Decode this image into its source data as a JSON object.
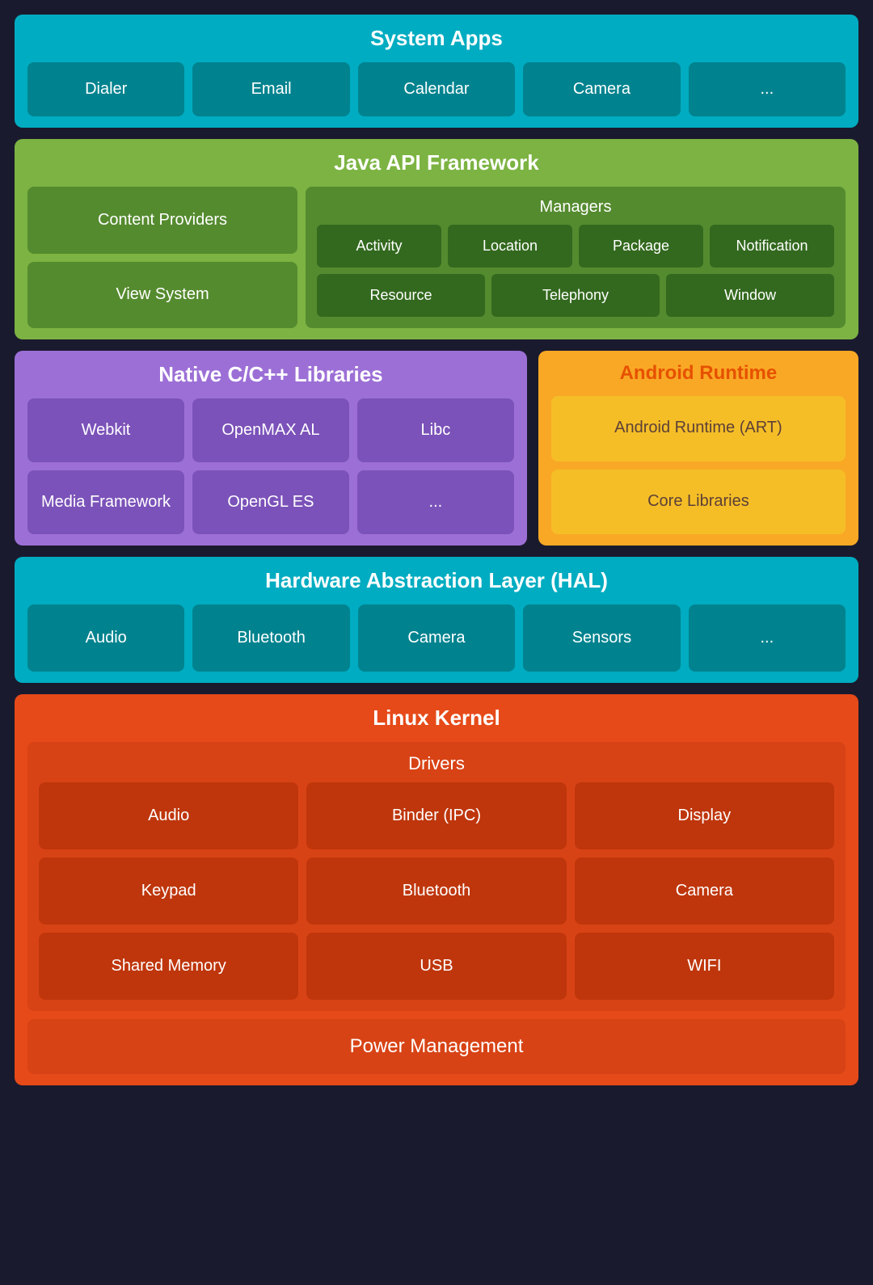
{
  "system_apps": {
    "title": "System Apps",
    "items": [
      "Dialer",
      "Email",
      "Calendar",
      "Camera",
      "..."
    ]
  },
  "java_api": {
    "title": "Java API Framework",
    "left": {
      "content_providers": "Content Providers",
      "view_system": "View System"
    },
    "managers": {
      "title": "Managers",
      "row1": [
        "Activity",
        "Location",
        "Package",
        "Notification"
      ],
      "row2": [
        "Resource",
        "Telephony",
        "Window"
      ]
    }
  },
  "native": {
    "title": "Native C/C++ Libraries",
    "items": [
      "Webkit",
      "OpenMAX AL",
      "Libc",
      "Media Framework",
      "OpenGL ES",
      "..."
    ]
  },
  "android_runtime": {
    "title": "Android Runtime",
    "items": [
      "Android Runtime (ART)",
      "Core Libraries"
    ]
  },
  "hal": {
    "title": "Hardware Abstraction Layer (HAL)",
    "items": [
      "Audio",
      "Bluetooth",
      "Camera",
      "Sensors",
      "..."
    ]
  },
  "linux_kernel": {
    "title": "Linux Kernel",
    "drivers": {
      "title": "Drivers",
      "items": [
        "Audio",
        "Binder (IPC)",
        "Display",
        "Keypad",
        "Bluetooth",
        "Camera",
        "Shared Memory",
        "USB",
        "WIFI"
      ]
    },
    "power_management": "Power Management"
  }
}
